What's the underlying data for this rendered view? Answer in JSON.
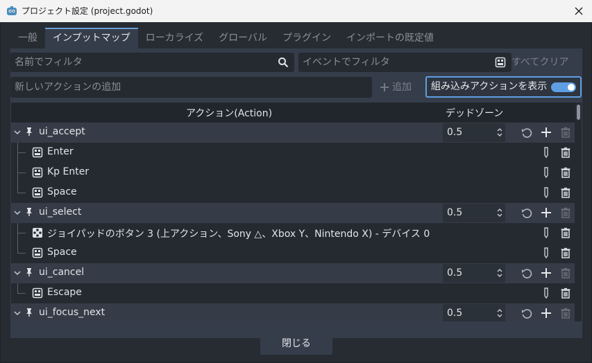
{
  "window": {
    "title": "プロジェクト設定 (project.godot)"
  },
  "tabs": [
    {
      "label": "一般"
    },
    {
      "label": "インプットマップ"
    },
    {
      "label": "ローカライズ"
    },
    {
      "label": "グローバル"
    },
    {
      "label": "プラグイン"
    },
    {
      "label": "インポートの既定値"
    }
  ],
  "filters": {
    "name_placeholder": "名前でフィルタ",
    "event_placeholder": "イベントでフィルタ",
    "clear_all_label": "すべてクリア"
  },
  "new_action": {
    "placeholder": "新しいアクションの追加",
    "add_label": "追加"
  },
  "builtin_toggle": {
    "label": "組み込みアクションを表示",
    "enabled": true
  },
  "table": {
    "col_action": "アクション(Action)",
    "col_deadzone": "デッドゾーン"
  },
  "actions": [
    {
      "name": "ui_accept",
      "deadzone": "0.5",
      "events": [
        {
          "name": "Enter",
          "kind": "keyboard"
        },
        {
          "name": "Kp Enter",
          "kind": "keyboard"
        },
        {
          "name": "Space",
          "kind": "keyboard"
        }
      ]
    },
    {
      "name": "ui_select",
      "deadzone": "0.5",
      "events": [
        {
          "name": "ジョイパッドのボタン 3 (上アクション、Sony △、Xbox Y、Nintendo X) - デバイス 0",
          "kind": "joypad"
        },
        {
          "name": "Space",
          "kind": "keyboard"
        }
      ]
    },
    {
      "name": "ui_cancel",
      "deadzone": "0.5",
      "events": [
        {
          "name": "Escape",
          "kind": "keyboard"
        }
      ]
    },
    {
      "name": "ui_focus_next",
      "deadzone": "0.5",
      "events": []
    }
  ],
  "footer": {
    "close_label": "閉じる"
  },
  "colors": {
    "accent": "#5e9fe3",
    "panel": "#363d4a",
    "background": "#272c33"
  }
}
